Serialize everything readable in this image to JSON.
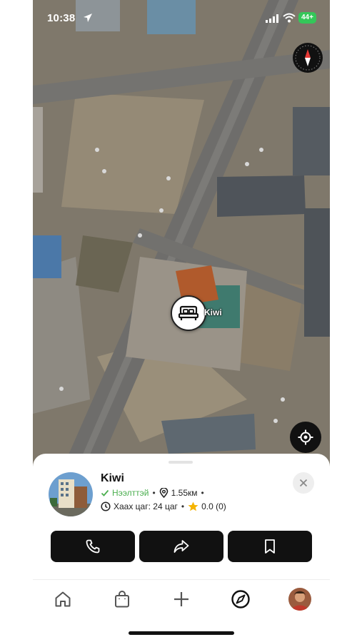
{
  "status_bar": {
    "time": "10:38",
    "battery": "44+"
  },
  "map": {
    "pin_label": "Kiwi",
    "icons": [
      "compass-icon",
      "locate-me-icon",
      "bed-icon"
    ]
  },
  "place": {
    "name": "Kiwi",
    "status": "Нээлттэй",
    "distance": "1.55км",
    "hours": "Хаах цаг: 24 цаг",
    "rating": "0.0 (0)",
    "colors": {
      "open": "#4caf50",
      "star": "#f5b400"
    }
  },
  "actions": [
    {
      "name": "call-button",
      "icon": "phone-icon"
    },
    {
      "name": "share-button",
      "icon": "share-arrow-icon"
    },
    {
      "name": "save-button",
      "icon": "bookmark-icon"
    }
  ],
  "tabbar": [
    {
      "name": "tab-home",
      "icon": "home-icon"
    },
    {
      "name": "tab-shop",
      "icon": "shopping-bag-icon"
    },
    {
      "name": "tab-add",
      "icon": "plus-icon"
    },
    {
      "name": "tab-explore",
      "icon": "compass-icon"
    },
    {
      "name": "tab-profile",
      "icon": "avatar"
    }
  ]
}
